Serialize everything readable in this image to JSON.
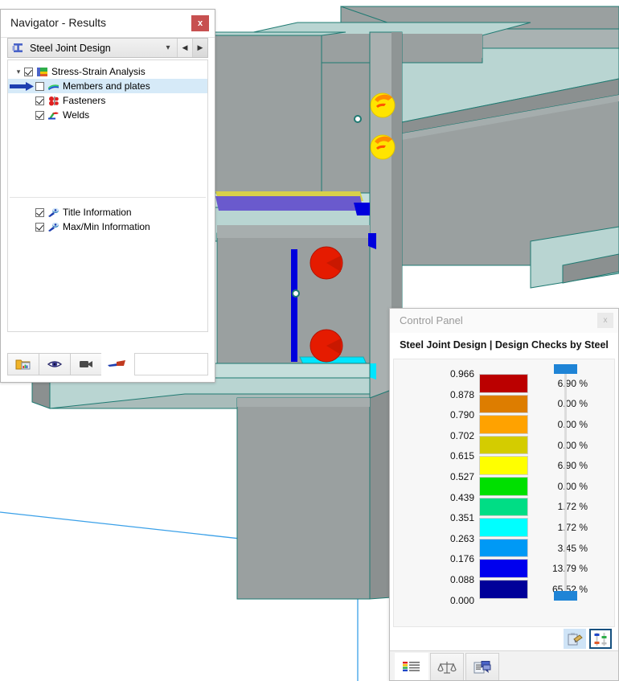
{
  "navigator": {
    "title": "Navigator - Results",
    "close_label": "x",
    "combo": {
      "label": "Steel Joint Design",
      "icon": "steel-beam-icon",
      "dropdown_icon": "chevron-down-icon",
      "prev_icon": "triangle-left-icon",
      "next_icon": "triangle-right-icon"
    },
    "tree": [
      {
        "label": "Stress-Strain Analysis",
        "checked": true,
        "expanded": true,
        "level": 0,
        "icon": "stress-strain-icon",
        "selected": false,
        "marker": false
      },
      {
        "label": "Members and plates",
        "checked": false,
        "expanded": null,
        "level": 1,
        "icon": "members-plates-icon",
        "selected": true,
        "marker": true
      },
      {
        "label": "Fasteners",
        "checked": true,
        "expanded": null,
        "level": 1,
        "icon": "fasteners-icon",
        "selected": false,
        "marker": false
      },
      {
        "label": "Welds",
        "checked": true,
        "expanded": null,
        "level": 1,
        "icon": "welds-icon",
        "selected": false,
        "marker": false
      }
    ],
    "tree_bottom": [
      {
        "label": "Title Information",
        "checked": true,
        "icon": "title-info-icon"
      },
      {
        "label": "Max/Min Information",
        "checked": true,
        "icon": "maxmin-info-icon"
      }
    ],
    "toolbar": [
      {
        "name": "open-results-button",
        "icon": "folder-results-icon"
      },
      {
        "name": "visibility-button",
        "icon": "eye-icon"
      },
      {
        "name": "animation-button",
        "icon": "video-camera-icon"
      },
      {
        "name": "arrow-tool-button",
        "icon": "arrow-marker-icon"
      }
    ]
  },
  "control_panel": {
    "title": "Control Panel",
    "close_label": "x",
    "subtitle": "Steel Joint Design | Design Checks by Steel Joints",
    "legend": {
      "values": [
        "0.966",
        "0.878",
        "0.790",
        "0.702",
        "0.615",
        "0.527",
        "0.439",
        "0.351",
        "0.263",
        "0.176",
        "0.088",
        "0.000"
      ],
      "bands": [
        {
          "color": "#bb0000",
          "percent": "6.90 %"
        },
        {
          "color": "#dd7d00",
          "percent": "0.00 %"
        },
        {
          "color": "#ffa200",
          "percent": "0.00 %"
        },
        {
          "color": "#d4cc00",
          "percent": "0.00 %"
        },
        {
          "color": "#ffff00",
          "percent": "6.90 %"
        },
        {
          "color": "#00e000",
          "percent": "0.00 %"
        },
        {
          "color": "#00dd85",
          "percent": "1.72 %"
        },
        {
          "color": "#00ffff",
          "percent": "1.72 %"
        },
        {
          "color": "#0099f5",
          "percent": "3.45 %"
        },
        {
          "color": "#0000ee",
          "percent": "13.79 %"
        },
        {
          "color": "#000099",
          "percent": "65.52 %"
        }
      ]
    },
    "slider": {
      "accent": "#1f84d6",
      "top_handle": "max-handle",
      "bottom_handle": "min-handle"
    },
    "icons": [
      {
        "name": "color-edit-button",
        "icon": "palette-edit-icon",
        "selected": false
      },
      {
        "name": "value-range-button",
        "icon": "range-sliders-icon",
        "selected": true
      }
    ],
    "tabs": [
      {
        "name": "tab-color-scale",
        "icon": "color-scale-icon",
        "active": true
      },
      {
        "name": "tab-factors",
        "icon": "balance-scale-icon",
        "active": false
      },
      {
        "name": "tab-display-properties",
        "icon": "display-properties-icon",
        "active": false
      }
    ]
  },
  "viewport": {
    "name": "steel-joint-3d-view",
    "background": "#ffffff",
    "colors": {
      "steel_face_light": "#b9d5d2",
      "steel_face_mid": "#9aa0a0",
      "steel_face_dark": "#8b9090",
      "edge": "#1f7a72",
      "grid_line": "#3aa0e8",
      "bolt_red": "#e51b00",
      "bolt_yellow": "#ffe400",
      "bolt_orange": "#ff8c00",
      "weld_blue": "#0000dd",
      "weld_violet": "#6a5acd",
      "weld_cyan": "#00e5ff",
      "weld_yellow": "#d8d04a"
    }
  }
}
